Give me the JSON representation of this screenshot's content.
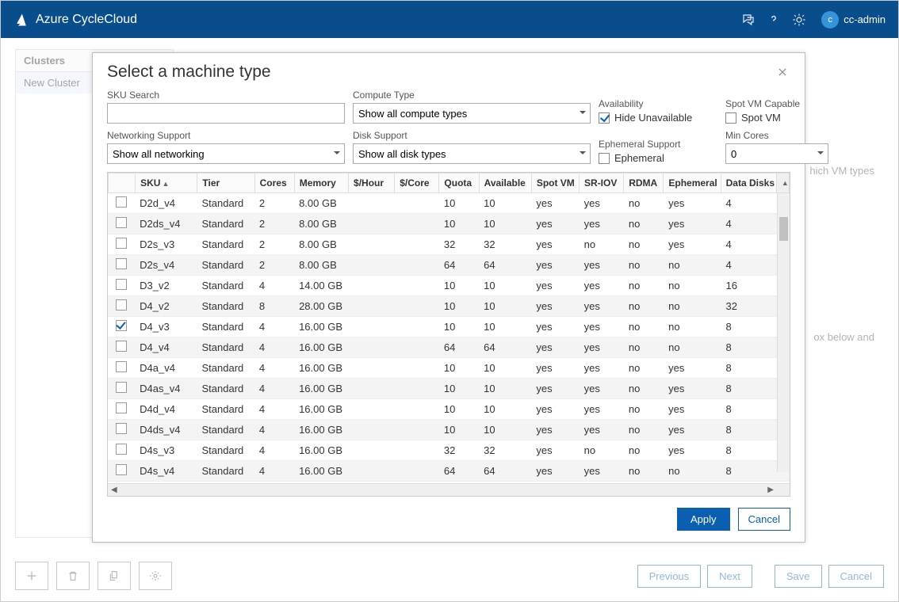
{
  "app": {
    "title": "Azure CycleCloud",
    "user_initial": "c",
    "user_name": "cc-admin"
  },
  "sidebar": {
    "title": "Clusters",
    "items": [
      "New Cluster"
    ]
  },
  "bg_hints": {
    "h1": "hich VM types",
    "h2": "ox below and"
  },
  "footer_buttons": {
    "previous": "Previous",
    "next": "Next",
    "save": "Save",
    "cancel": "Cancel"
  },
  "modal": {
    "title": "Select a machine type",
    "filters": {
      "sku_search": {
        "label": "SKU Search",
        "value": ""
      },
      "compute_type": {
        "label": "Compute Type",
        "value": "Show all compute types"
      },
      "availability": {
        "label": "Availability",
        "check_label": "Hide Unavailable",
        "checked": true
      },
      "spot_capable": {
        "label": "Spot VM Capable",
        "check_label": "Spot VM",
        "checked": false
      },
      "networking": {
        "label": "Networking Support",
        "value": "Show all networking"
      },
      "disk": {
        "label": "Disk Support",
        "value": "Show all disk types"
      },
      "ephemeral": {
        "label": "Ephemeral Support",
        "check_label": "Ephemeral",
        "checked": false
      },
      "min_cores": {
        "label": "Min Cores",
        "value": "0"
      }
    },
    "columns": [
      "SKU",
      "Tier",
      "Cores",
      "Memory",
      "$/Hour",
      "$/Core",
      "Quota",
      "Available",
      "Spot VM",
      "SR-IOV",
      "RDMA",
      "Ephemeral",
      "Data Disks"
    ],
    "sort_col": "SKU",
    "rows": [
      {
        "sel": false,
        "sku": "D2d_v4",
        "tier": "Standard",
        "cores": "2",
        "mem": "8.00 GB",
        "ph": "",
        "pc": "",
        "quota": "10",
        "avail": "10",
        "spot": "yes",
        "sriov": "yes",
        "rdma": "no",
        "eph": "yes",
        "disks": "4"
      },
      {
        "sel": false,
        "sku": "D2ds_v4",
        "tier": "Standard",
        "cores": "2",
        "mem": "8.00 GB",
        "ph": "",
        "pc": "",
        "quota": "10",
        "avail": "10",
        "spot": "yes",
        "sriov": "yes",
        "rdma": "no",
        "eph": "yes",
        "disks": "4"
      },
      {
        "sel": false,
        "sku": "D2s_v3",
        "tier": "Standard",
        "cores": "2",
        "mem": "8.00 GB",
        "ph": "",
        "pc": "",
        "quota": "32",
        "avail": "32",
        "spot": "yes",
        "sriov": "no",
        "rdma": "no",
        "eph": "yes",
        "disks": "4"
      },
      {
        "sel": false,
        "sku": "D2s_v4",
        "tier": "Standard",
        "cores": "2",
        "mem": "8.00 GB",
        "ph": "",
        "pc": "",
        "quota": "64",
        "avail": "64",
        "spot": "yes",
        "sriov": "yes",
        "rdma": "no",
        "eph": "no",
        "disks": "4"
      },
      {
        "sel": false,
        "sku": "D3_v2",
        "tier": "Standard",
        "cores": "4",
        "mem": "14.00 GB",
        "ph": "",
        "pc": "",
        "quota": "10",
        "avail": "10",
        "spot": "yes",
        "sriov": "yes",
        "rdma": "no",
        "eph": "no",
        "disks": "16"
      },
      {
        "sel": false,
        "sku": "D4_v2",
        "tier": "Standard",
        "cores": "8",
        "mem": "28.00 GB",
        "ph": "",
        "pc": "",
        "quota": "10",
        "avail": "10",
        "spot": "yes",
        "sriov": "yes",
        "rdma": "no",
        "eph": "no",
        "disks": "32"
      },
      {
        "sel": true,
        "sku": "D4_v3",
        "tier": "Standard",
        "cores": "4",
        "mem": "16.00 GB",
        "ph": "",
        "pc": "",
        "quota": "10",
        "avail": "10",
        "spot": "yes",
        "sriov": "yes",
        "rdma": "no",
        "eph": "no",
        "disks": "8"
      },
      {
        "sel": false,
        "sku": "D4_v4",
        "tier": "Standard",
        "cores": "4",
        "mem": "16.00 GB",
        "ph": "",
        "pc": "",
        "quota": "64",
        "avail": "64",
        "spot": "yes",
        "sriov": "yes",
        "rdma": "no",
        "eph": "no",
        "disks": "8"
      },
      {
        "sel": false,
        "sku": "D4a_v4",
        "tier": "Standard",
        "cores": "4",
        "mem": "16.00 GB",
        "ph": "",
        "pc": "",
        "quota": "10",
        "avail": "10",
        "spot": "yes",
        "sriov": "yes",
        "rdma": "no",
        "eph": "yes",
        "disks": "8"
      },
      {
        "sel": false,
        "sku": "D4as_v4",
        "tier": "Standard",
        "cores": "4",
        "mem": "16.00 GB",
        "ph": "",
        "pc": "",
        "quota": "10",
        "avail": "10",
        "spot": "yes",
        "sriov": "yes",
        "rdma": "no",
        "eph": "yes",
        "disks": "8"
      },
      {
        "sel": false,
        "sku": "D4d_v4",
        "tier": "Standard",
        "cores": "4",
        "mem": "16.00 GB",
        "ph": "",
        "pc": "",
        "quota": "10",
        "avail": "10",
        "spot": "yes",
        "sriov": "yes",
        "rdma": "no",
        "eph": "yes",
        "disks": "8"
      },
      {
        "sel": false,
        "sku": "D4ds_v4",
        "tier": "Standard",
        "cores": "4",
        "mem": "16.00 GB",
        "ph": "",
        "pc": "",
        "quota": "10",
        "avail": "10",
        "spot": "yes",
        "sriov": "yes",
        "rdma": "no",
        "eph": "yes",
        "disks": "8"
      },
      {
        "sel": false,
        "sku": "D4s_v3",
        "tier": "Standard",
        "cores": "4",
        "mem": "16.00 GB",
        "ph": "",
        "pc": "",
        "quota": "32",
        "avail": "32",
        "spot": "yes",
        "sriov": "no",
        "rdma": "no",
        "eph": "yes",
        "disks": "8"
      },
      {
        "sel": false,
        "sku": "D4s_v4",
        "tier": "Standard",
        "cores": "4",
        "mem": "16.00 GB",
        "ph": "",
        "pc": "",
        "quota": "64",
        "avail": "64",
        "spot": "yes",
        "sriov": "yes",
        "rdma": "no",
        "eph": "no",
        "disks": "8"
      }
    ],
    "apply": "Apply",
    "cancel": "Cancel"
  }
}
